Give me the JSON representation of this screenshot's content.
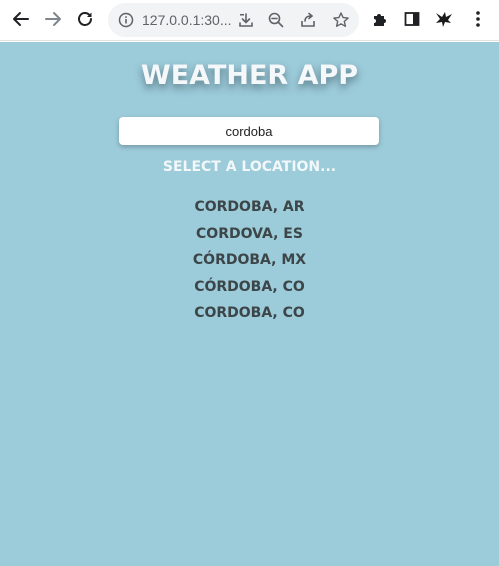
{
  "browser": {
    "url": "127.0.0.1:30..."
  },
  "app": {
    "title": "WEATHER APP",
    "search": {
      "value": "cordoba",
      "placeholder": ""
    },
    "prompt": "SELECT A LOCATION...",
    "locations": [
      "CORDOBA, AR",
      "CORDOVA, ES",
      "CÓRDOBA, MX",
      "CÓRDOBA, CO",
      "CORDOBA, CO"
    ],
    "colors": {
      "background": "#9ccbda",
      "title": "#f4f8fa",
      "location_text": "#3c4548"
    }
  }
}
